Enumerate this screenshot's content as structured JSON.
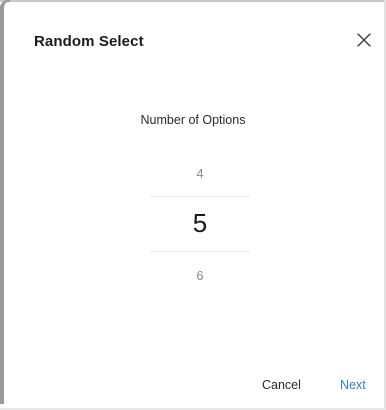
{
  "dialog": {
    "title": "Random Select"
  },
  "picker": {
    "label": "Number of Options",
    "previous_value": "4",
    "selected_value": "5",
    "next_value": "6"
  },
  "actions": {
    "cancel_label": "Cancel",
    "next_label": "Next"
  },
  "colors": {
    "accent": "#2f82c8",
    "text_primary": "#1a1a1a",
    "text_muted": "#8a8a8a"
  },
  "icons": {
    "close": "close-icon"
  }
}
